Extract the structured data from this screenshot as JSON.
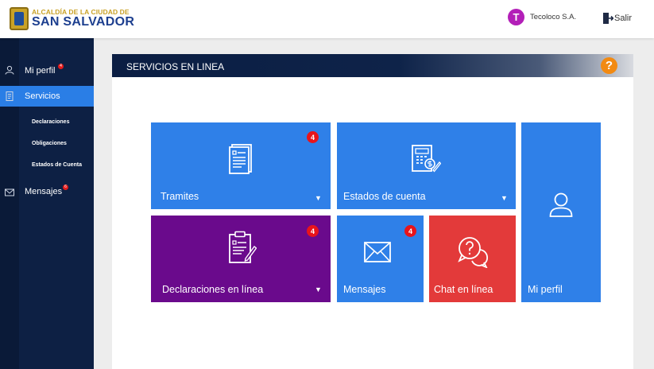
{
  "header": {
    "logo_line1": "ALCALDÍA DE LA CIUDAD DE",
    "logo_line2": "SAN SALVADOR",
    "user_initial": "T",
    "user_name": "Tecoloco S.A.",
    "logout_label": "Salir"
  },
  "sidebar": {
    "items": [
      {
        "label": "Mi perfil",
        "badge": "4"
      },
      {
        "label": "Servicios"
      },
      {
        "label": "Mensajes",
        "badge": "6"
      }
    ],
    "sub_items": [
      {
        "label": "Declaraciones"
      },
      {
        "label": "Obligaciones"
      },
      {
        "label": "Estados de Cuenta"
      }
    ]
  },
  "panel": {
    "title": "SERVICIOS EN LINEA",
    "help": "?"
  },
  "tiles": [
    {
      "label": "Tramites",
      "badge": "4",
      "caret": "▼"
    },
    {
      "label": "Estados de cuenta",
      "caret": "▼"
    },
    {
      "label": "Mi perfil"
    },
    {
      "label": "Declaraciones en línea",
      "badge": "4",
      "caret": "▼"
    },
    {
      "label": "Mensajes",
      "badge": "4"
    },
    {
      "label": "Chat en línea"
    }
  ],
  "colors": {
    "tile_blue": "#2f80e8",
    "tile_purple": "#6a0a8c",
    "tile_red": "#e33a3a",
    "sidebar": "#0d2044",
    "sidebar_active": "#2a7ee6",
    "badge": "#e8141b",
    "help": "#f28a12"
  }
}
